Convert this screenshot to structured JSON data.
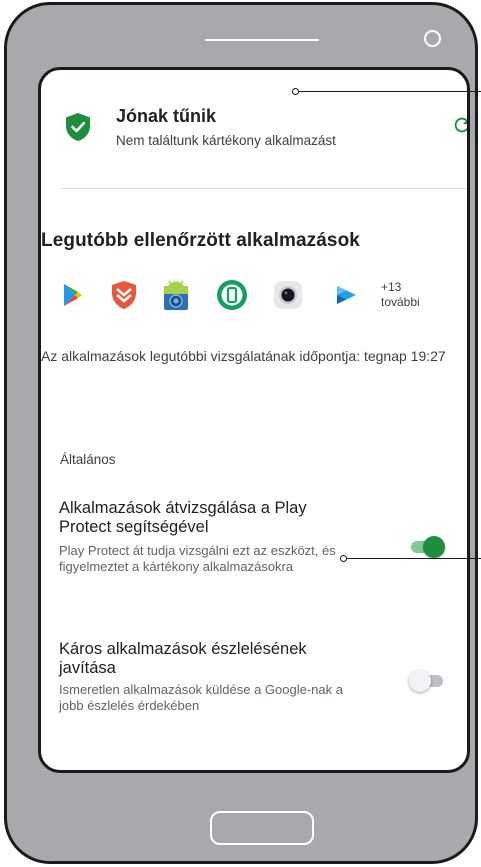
{
  "status": {
    "title": "Jónak tűnik",
    "subtitle": "Nem találtunk kártékony alkalmazást"
  },
  "recent": {
    "title": "Legutóbb ellenőrzött alkalmazások",
    "more_count": "+13",
    "more_label": "további",
    "apps": [
      "play-store-icon",
      "shield-app-icon",
      "android-device-icon",
      "circle-phone-app-icon",
      "camera-lens-app-icon",
      "play-movies-icon"
    ]
  },
  "scan_time": {
    "text": "Az alkalmazások legutóbbi vizsgálatának időpontja: tegnap 19:27"
  },
  "general": {
    "label": "Általános"
  },
  "settings": [
    {
      "title": "Alkalmazások átvizsgálása a Play Protect segítségével",
      "description": "Play Protect át tudja vizsgálni ezt az eszközt, és figyelmeztet a kártékony alkalmazásokra",
      "enabled": true
    },
    {
      "title": "Káros alkalmazások észlelésének javítása",
      "description": "Ismeretlen alkalmazások küldése a Google-nak a jobb észlelés érdekében",
      "enabled": false
    }
  ],
  "colors": {
    "accent_green": "#1e8e3e",
    "toggle_on_track": "#81c995",
    "toggle_off_track": "#bdc1c6",
    "toggle_off_knob": "#f1f3f4",
    "phone_body": "#a7a9ac"
  }
}
